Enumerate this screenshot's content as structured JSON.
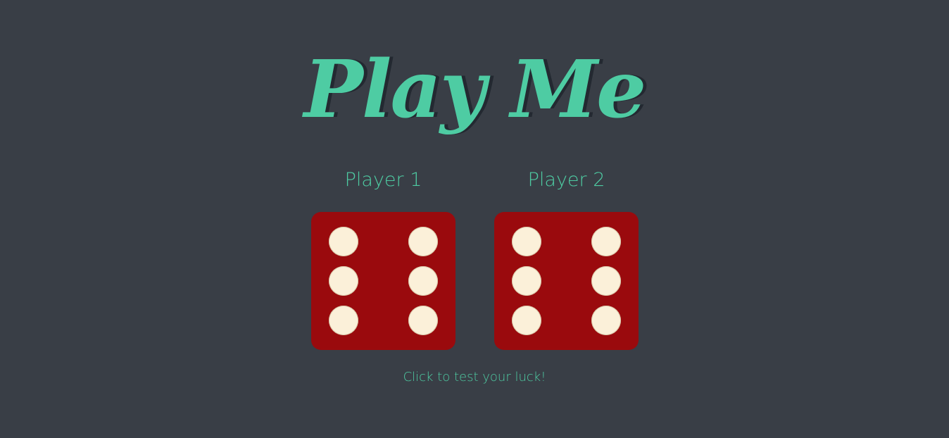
{
  "game": {
    "title": "Play Me",
    "players": [
      {
        "label": "Player 1",
        "die_face": 6
      },
      {
        "label": "Player 2",
        "die_face": 6
      }
    ],
    "hint": "Click to test your luck!"
  },
  "colors": {
    "background": "#393e46",
    "accent": "#4ecca3",
    "die": "#9a0a0d",
    "pip": "#fbf0d9"
  }
}
